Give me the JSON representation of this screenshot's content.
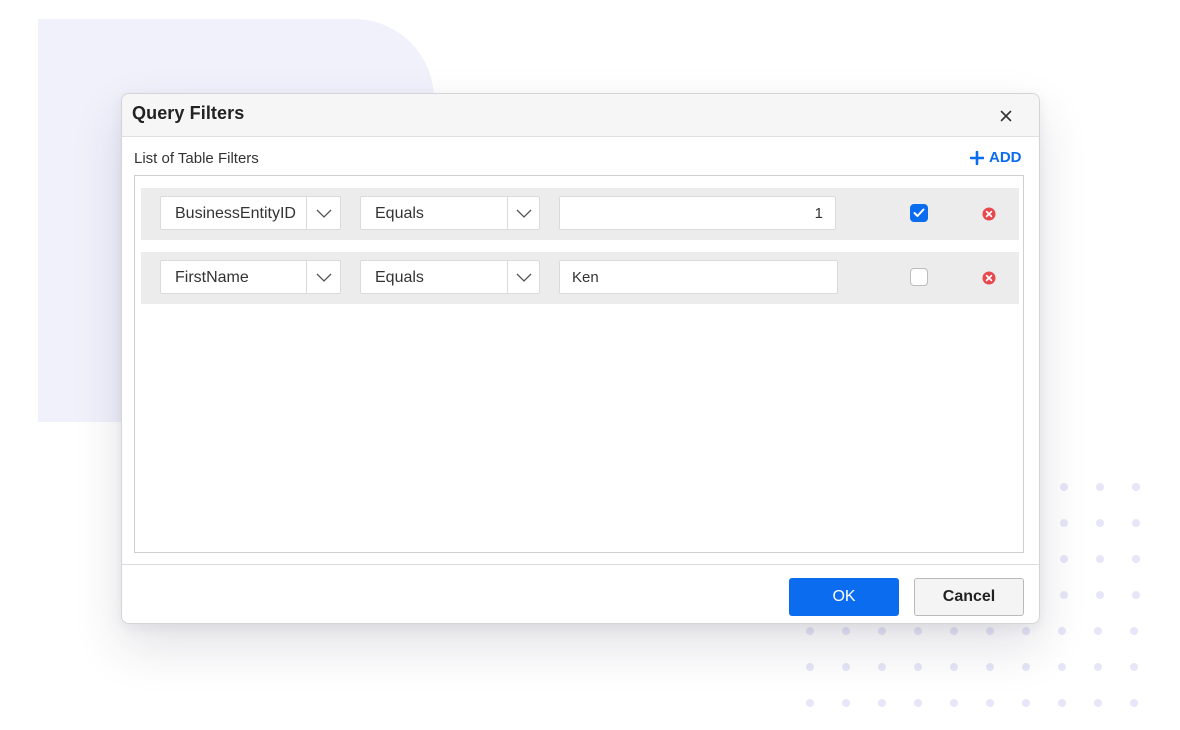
{
  "dialog": {
    "title": "Query Filters",
    "close_icon": "close-icon"
  },
  "section": {
    "label": "List of Table Filters",
    "add_label": "ADD",
    "add_icon": "plus-icon"
  },
  "filters": [
    {
      "field": "BusinessEntityID",
      "operator": "Equals",
      "value": "1",
      "checked": true
    },
    {
      "field": "FirstName",
      "operator": "Equals",
      "value": "Ken",
      "checked": false
    }
  ],
  "footer": {
    "ok_label": "OK",
    "cancel_label": "Cancel"
  },
  "colors": {
    "accent": "#0b6cf0",
    "remove": "#e5484d",
    "background_blob": "#f1f1fc",
    "dots": "#e6e6f8"
  }
}
